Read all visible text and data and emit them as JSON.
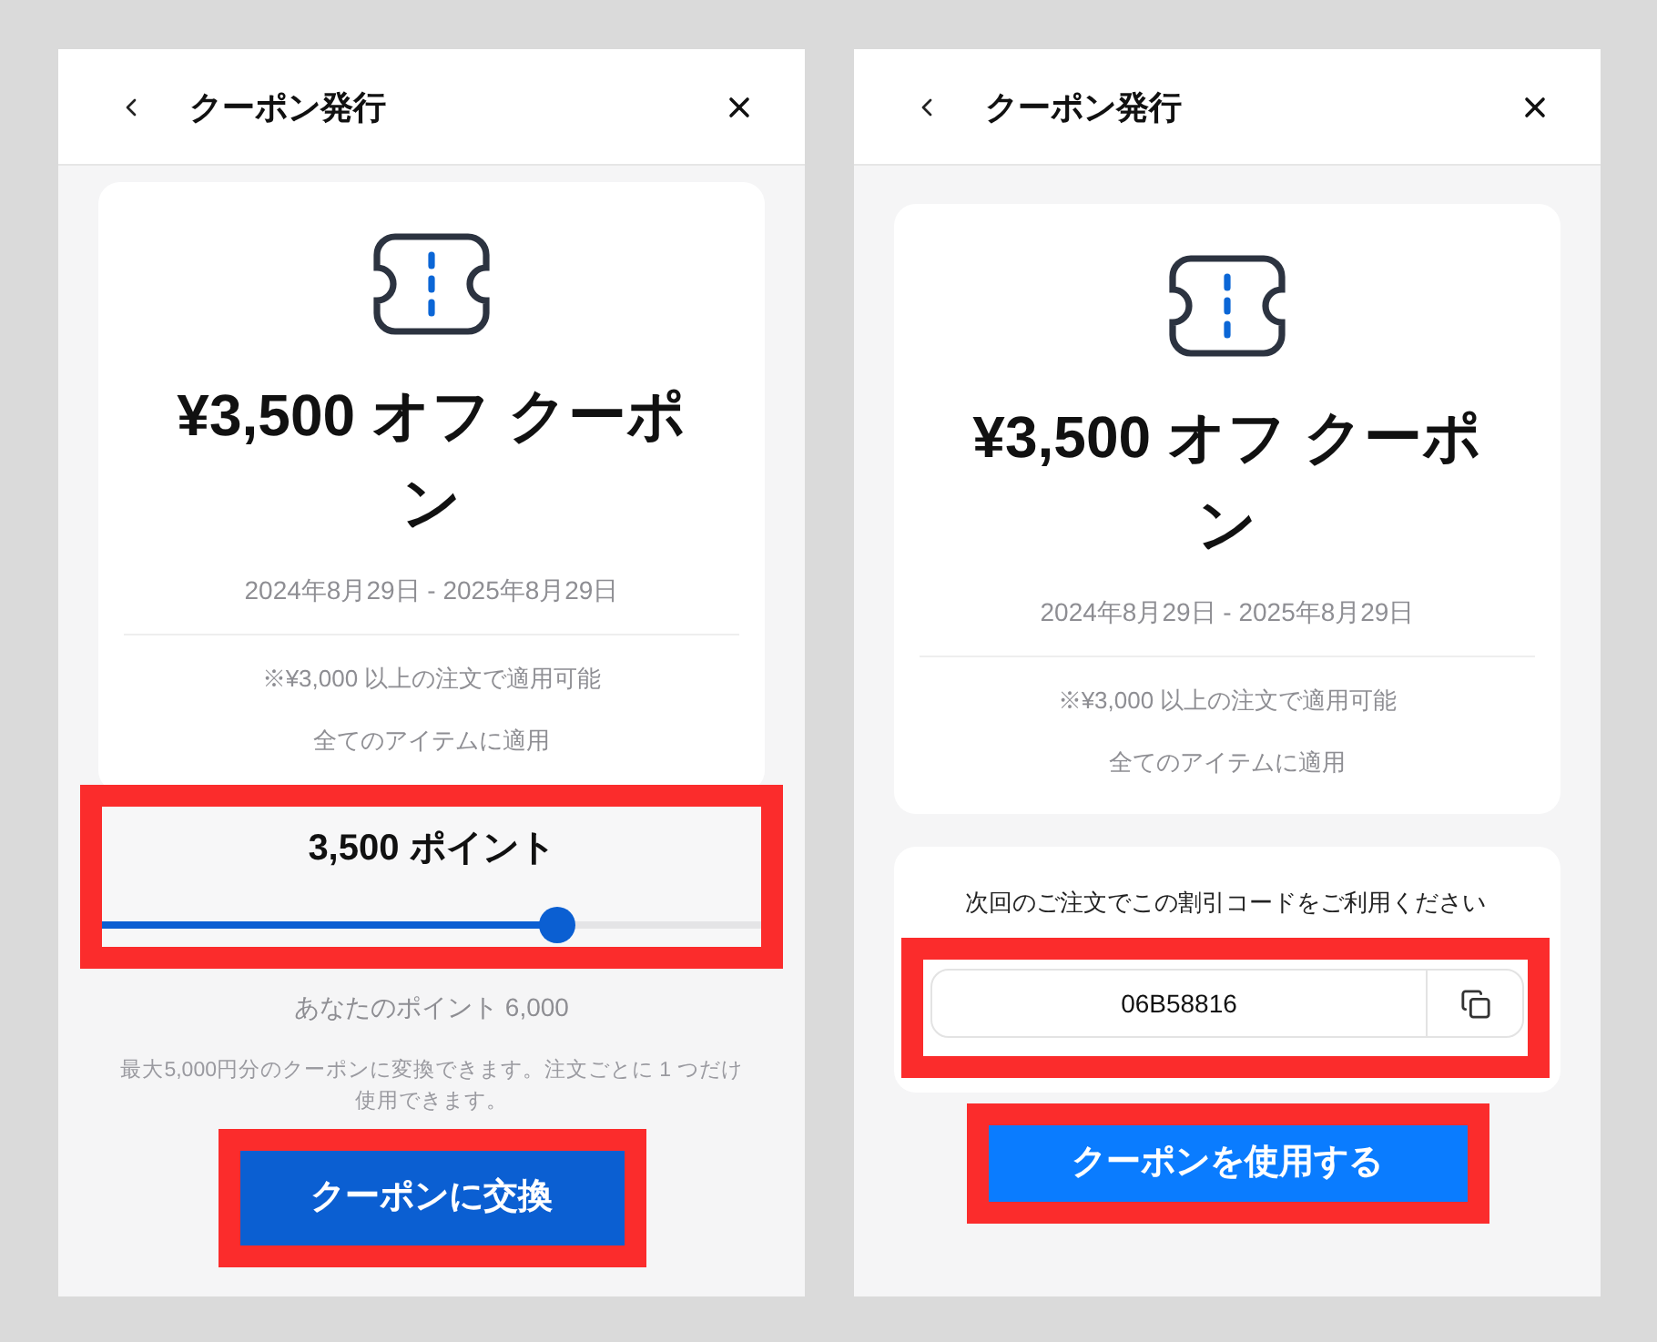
{
  "panels": [
    {
      "kind": "redeem",
      "header": {
        "title": "クーポン発行"
      },
      "coupon": {
        "title": "¥3,500 オフ クーポン",
        "validity": "2024年8月29日 - 2025年8月29日",
        "conditions": [
          "※¥3,000 以上の注文で適用可能",
          "全てのアイテムに適用"
        ]
      },
      "points_selector": {
        "highlighted": true,
        "label": "3,500 ポイント",
        "level": 0.69
      },
      "balance": "あなたのポイント 6,000",
      "note": "最大5,000円分のクーポンに変換できます。注文ごとに 1 つだけ使用できます。",
      "button": {
        "label": "クーポンに交換",
        "highlighted": true
      }
    },
    {
      "kind": "code",
      "header": {
        "title": "クーポン発行"
      },
      "coupon": {
        "title": "¥3,500 オフ クーポン",
        "validity": "2024年8月29日 - 2025年8月29日",
        "conditions": [
          "※¥3,000 以上の注文で適用可能",
          "全てのアイテムに適用"
        ]
      },
      "code_section": {
        "instruction": "次回のご注文でこの割引コードをご利用ください",
        "code": "06B58816",
        "highlighted": true
      },
      "button": {
        "label": "クーポンを使用する",
        "highlighted": true
      }
    }
  ]
}
